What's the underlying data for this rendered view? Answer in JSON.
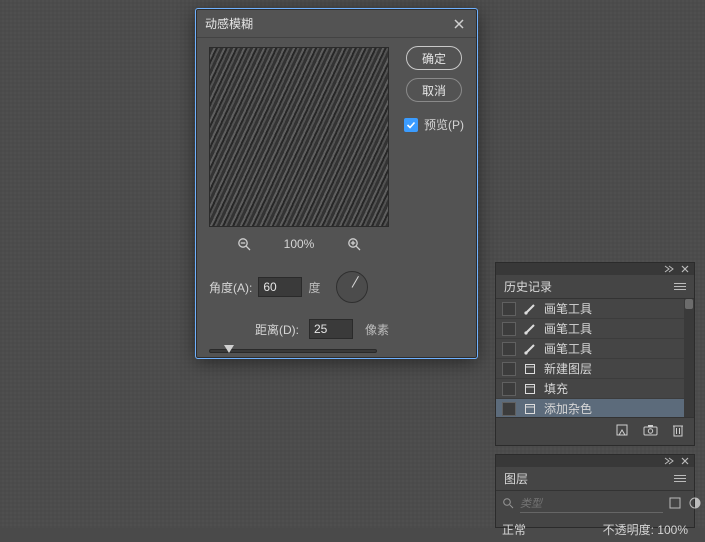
{
  "dialog": {
    "title": "动感模糊",
    "ok": "确定",
    "cancel": "取消",
    "preview_label": "预览(P)",
    "zoom_pct": "100%",
    "angle_label": "角度(A):",
    "angle_value": "60",
    "angle_unit": "度",
    "distance_label": "距离(D):",
    "distance_value": "25",
    "distance_unit": "像素"
  },
  "history": {
    "title": "历史记录",
    "items": [
      {
        "icon": "brush-icon",
        "label": "画笔工具"
      },
      {
        "icon": "brush-icon",
        "label": "画笔工具"
      },
      {
        "icon": "brush-icon",
        "label": "画笔工具"
      },
      {
        "icon": "layer-icon",
        "label": "新建图层"
      },
      {
        "icon": "layer-icon",
        "label": "填充"
      },
      {
        "icon": "layer-icon",
        "label": "添加杂色"
      }
    ]
  },
  "layers": {
    "title": "图层",
    "search_placeholder": "类型",
    "status_left": "正常",
    "status_right": "不透明度: 100%"
  }
}
